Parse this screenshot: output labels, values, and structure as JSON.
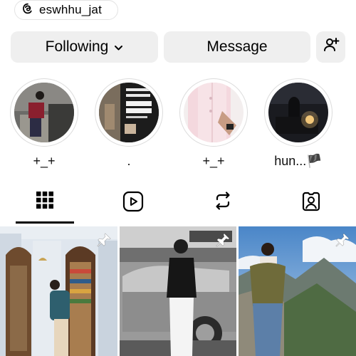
{
  "profile": {
    "threads_username": "eswhhu_jat"
  },
  "actions": {
    "following_label": "Following",
    "message_label": "Message"
  },
  "highlights": [
    {
      "label": "+_+"
    },
    {
      "label": "."
    },
    {
      "label": "+_+"
    },
    {
      "label": "hun...🏴"
    }
  ],
  "tabs": [
    "posts-grid",
    "reels",
    "reposts",
    "tagged"
  ],
  "colors": {
    "button_bg": "#efefef",
    "ring": "#dcdcdc",
    "active_tab": "#000000"
  },
  "icons": {
    "threads": "threads-icon",
    "chevron": "chevron-down-icon",
    "add_user": "add-user-icon",
    "pin": "pin-icon"
  }
}
